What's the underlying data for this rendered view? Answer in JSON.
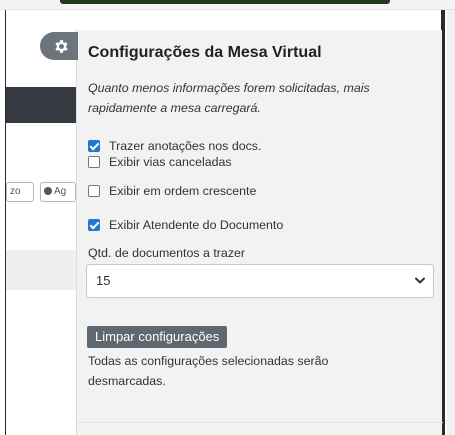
{
  "background": {
    "btn1_label": "zo",
    "btn2_label": "Ag"
  },
  "panel": {
    "title": "Configurações da Mesa Virtual",
    "hint": "Quanto menos informações forem solicitadas, mais rapidamente a mesa carregará.",
    "options": [
      {
        "label": "Trazer anotações nos docs.",
        "checked": true
      },
      {
        "label": "Exibir vias canceladas",
        "checked": false
      },
      {
        "label": "Exibir em ordem crescente",
        "checked": false
      },
      {
        "label": "Exibir Atendente do Documento",
        "checked": true
      }
    ],
    "qtd_label": "Qtd. de documentos a trazer",
    "qtd_value": "15",
    "clear_button": "Limpar configurações",
    "clear_note": "Todas as configurações selecionadas serão desmarcadas."
  },
  "icons": {
    "gear": "gear-icon",
    "chevron": "chevron-down-icon",
    "clock": "clock-icon"
  },
  "colors": {
    "checkbox_checked": "#1f77d0",
    "gear_button": "#6c757d",
    "clear_button": "#5f6770",
    "navbar": "#343a40"
  }
}
